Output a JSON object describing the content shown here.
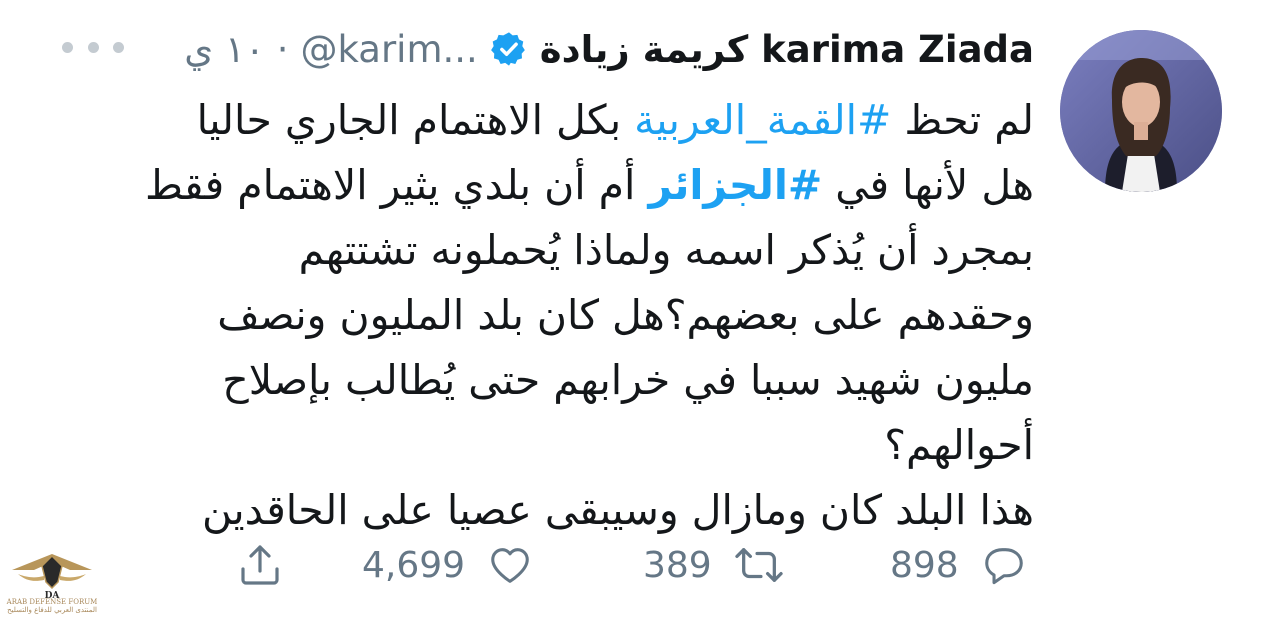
{
  "tweet": {
    "display_name": "كريمة زيادة karima Ziada",
    "handle": "@karim...",
    "separator": "·",
    "time": "١٠ ي",
    "verified": true,
    "lines": [
      {
        "before": "لم تحظ ",
        "tag": "#القمة_العربية",
        "after": " بكل الاهتمام الجاري حاليا"
      },
      {
        "before": "هل لأنها في ",
        "tag": "#الجزائر",
        "after": " أم أن بلدي يثير الاهتمام فقط"
      },
      {
        "text": "بمجرد أن يُذكر اسمه ولماذا يُحملونه تشتتهم"
      },
      {
        "text": "وحقدهم على بعضهم؟هل كان بلد المليون ونصف"
      },
      {
        "text": "مليون شهيد سببا في خرابهم حتى يُطالب بإصلاح"
      },
      {
        "text": "أحوالهم؟"
      },
      {
        "text": "هذا البلد كان ومازال وسيبقى عصيا على الحاقدين"
      }
    ]
  },
  "actions": {
    "replies": "898",
    "retweets": "389",
    "likes": "4,699"
  },
  "watermark": {
    "text": "ARAB DEFENSE FORUM\nالمنتدى العربي للدفاع والتسليح",
    "initials": "DA"
  },
  "colors": {
    "text": "#14171a",
    "secondary": "#657786",
    "link": "#1da1f2",
    "verified": "#1da1f2"
  },
  "icons": [
    "verified-badge-icon",
    "more-icon",
    "reply-icon",
    "retweet-icon",
    "like-icon",
    "share-icon"
  ]
}
